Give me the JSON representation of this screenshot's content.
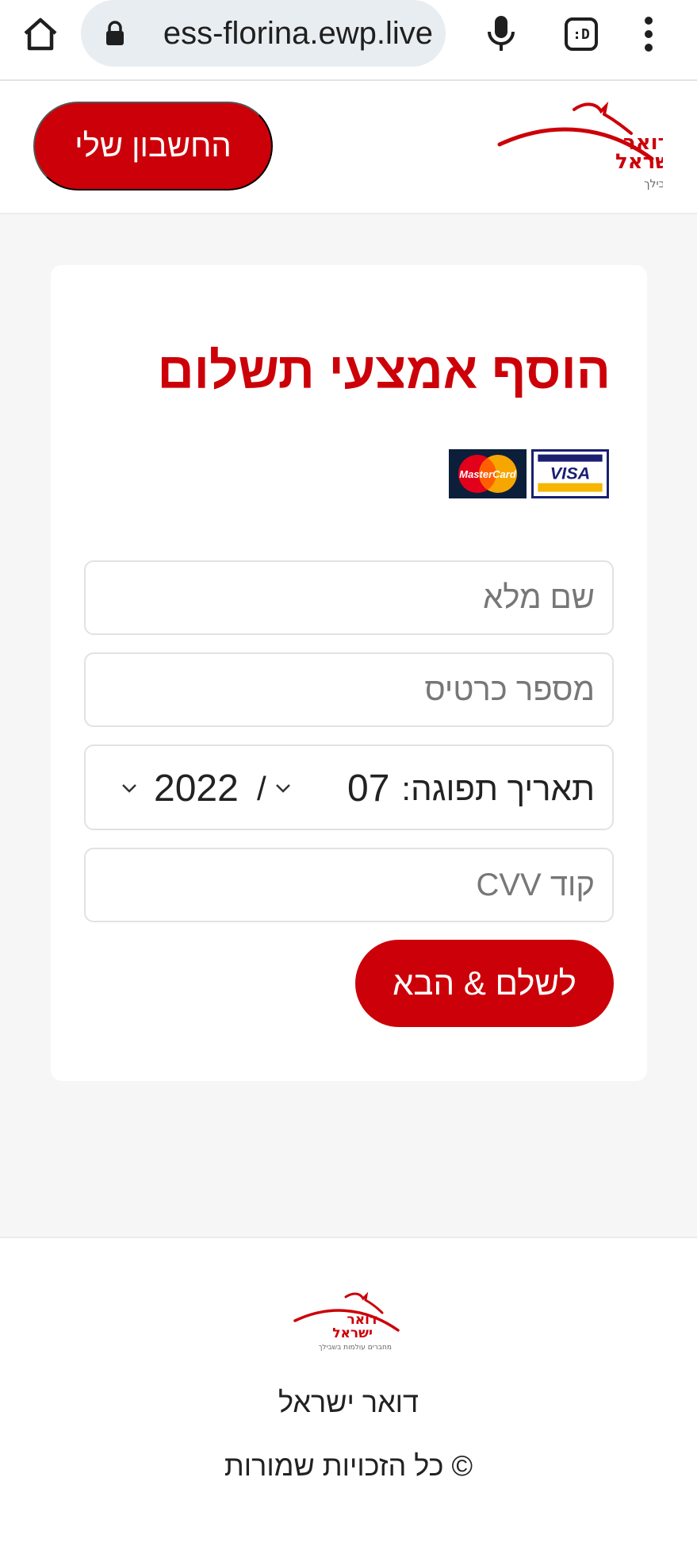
{
  "browser": {
    "url": "ess-florina.ewp.live",
    "tabs_label": ":D",
    "icons": [
      "home-icon",
      "lock-icon",
      "mic-icon",
      "tabs-icon",
      "menu-icon"
    ]
  },
  "header": {
    "account_button": "החשבון שלי",
    "logo": {
      "name_line1": "דואר",
      "name_line2": "ישראל",
      "tagline": "מחברים עולמות בשבילך"
    }
  },
  "form": {
    "title": "הוסף אמצעי תשלום",
    "card_logos": [
      "MasterCard",
      "VISA"
    ],
    "full_name_placeholder": "שם מלא",
    "card_number_placeholder": "מספר כרטיס",
    "expiry_label": "תאריך תפוגה:",
    "expiry_month": "07",
    "expiry_separator": "/",
    "expiry_year": "2022",
    "cvv_placeholder": "קוד CVV",
    "submit_label": "לשלם & הבא"
  },
  "footer": {
    "name": "דואר ישראל",
    "copyright": "© כל הזכויות שמורות"
  },
  "colors": {
    "brand_red": "#cc0008",
    "page_bg": "#f6f6f6",
    "url_bar_bg": "#e8edf1"
  }
}
